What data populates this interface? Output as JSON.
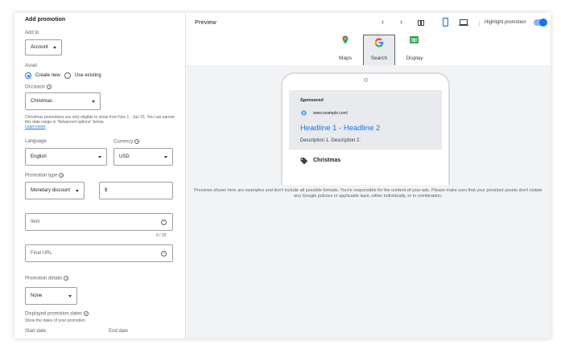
{
  "left": {
    "title": "Add promotion",
    "add_to_label": "Add to",
    "add_to_value": "Account",
    "asset_label": "Asset",
    "asset_options": [
      "Create new",
      "Use existing"
    ],
    "occasion_label": "Occasion",
    "occasion_value": "Christmas",
    "occasion_note": "Christmas promotions are only eligible to show from Nov 1 - Jan 15. You can narrow this date range in \"Advanced options\" below.",
    "learn_more": "Learn more",
    "language_label": "Language",
    "language_value": "English",
    "currency_label": "Currency",
    "currency_value": "USD",
    "promotion_type_label": "Promotion type",
    "promotion_type_value": "Monetary discount",
    "amount_prefix": "$",
    "item_placeholder": "Item",
    "item_counter": "0 / 20",
    "final_url_placeholder": "Final URL",
    "promotion_details_label": "Promotion details",
    "promotion_details_value": "None",
    "displayed_dates_label": "Displayed promotion dates",
    "displayed_dates_sub": "Show the dates of your promotion",
    "start_date_label": "Start date",
    "end_date_label": "End date"
  },
  "preview": {
    "title": "Preview",
    "highlight_label": "Highlight promotion",
    "highlight_on": true,
    "tabs": [
      {
        "label": "Maps",
        "icon": "maps-pin-icon"
      },
      {
        "label": "Search",
        "icon": "google-g-icon",
        "selected": true
      },
      {
        "label": "Display",
        "icon": "display-icon"
      }
    ],
    "sponsored": "Sponsored",
    "url": "www.example.com/",
    "headline": "Headline 1 - Headline 2",
    "description": "Description 1. Description 2.",
    "promotion_text": "Christmas",
    "disclaimer": "Previews shown here are examples and don't include all possible formats. You're responsible for the content of your ads. Please make sure that your provided assets don't violate any Google policies or applicable laws, either individually, or in combination."
  },
  "colors": {
    "accent": "#1a73e8",
    "headline": "#1a0dab",
    "panel_bg": "#f1f3f4"
  }
}
